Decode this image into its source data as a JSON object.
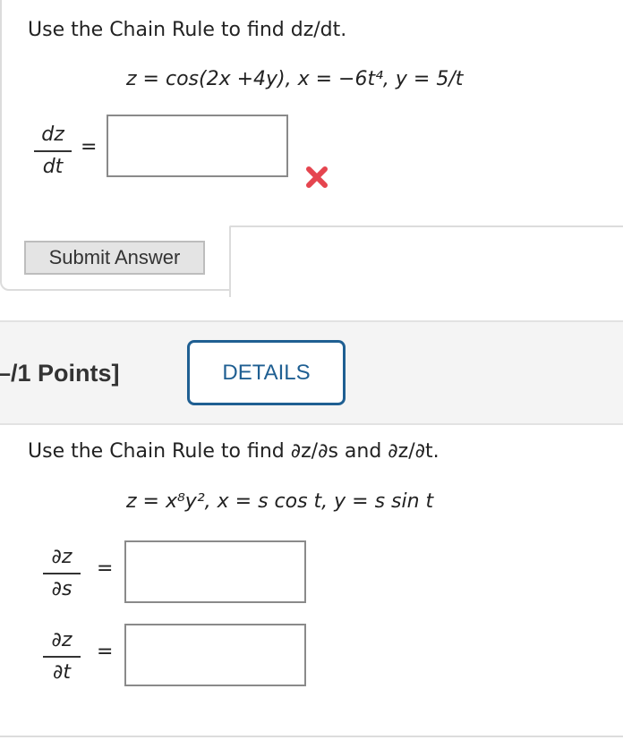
{
  "question1": {
    "title": "Use the Chain Rule to find dz/dt.",
    "formula": "z = cos(2x +4y),     x = −6t⁴,    y = 5/t",
    "derivative_numerator": "dz",
    "derivative_denominator": "dt",
    "equals": "=",
    "answer_value": "",
    "status_icon": "incorrect-x-icon",
    "submit_label": "Submit Answer"
  },
  "question2": {
    "points_label": "–/1 Points]",
    "details_label": "DETAILS",
    "title": "Use the Chain Rule to find ∂z/∂s and ∂z/∂t.",
    "formula": "z = x⁸y²,   x = s cos t,    y = s sin t",
    "ds_numerator": "∂z",
    "ds_denominator": "∂s",
    "dt_numerator": "∂z",
    "dt_denominator": "∂t",
    "equals": "=",
    "answer_ds_value": "",
    "answer_dt_value": ""
  },
  "colors": {
    "accent": "#1f5f92",
    "error": "#e5454f",
    "border": "#dcdcdc"
  }
}
